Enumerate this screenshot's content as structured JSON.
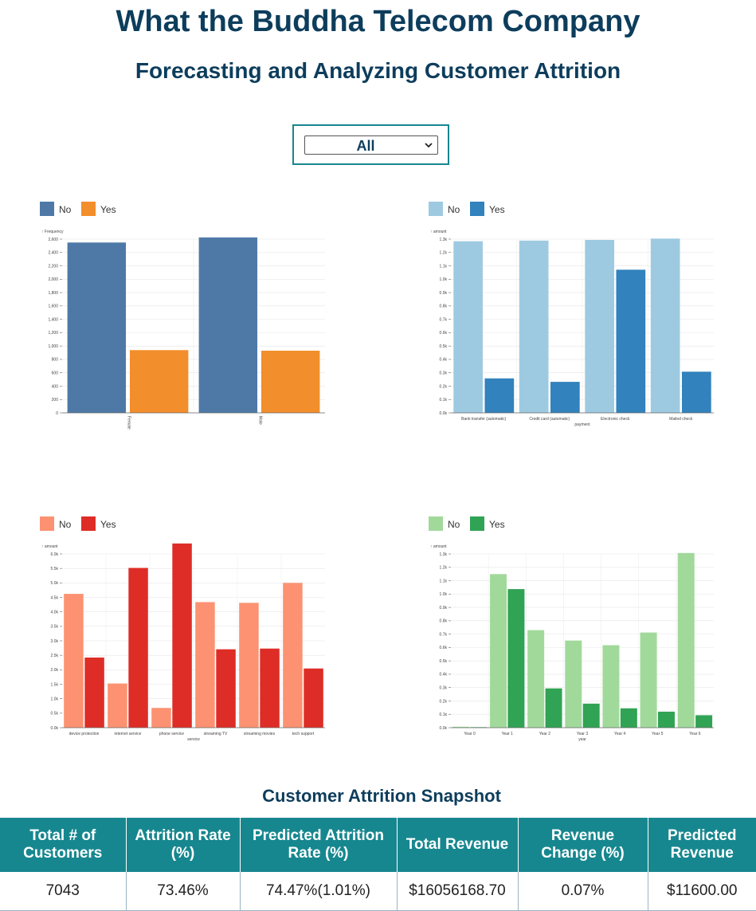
{
  "header": {
    "title": "What the Buddha Telecom Company",
    "subtitle": "Forecasting and Analyzing Customer Attrition"
  },
  "filter": {
    "selected": "All"
  },
  "chart_data": [
    {
      "id": "gender",
      "type": "bar",
      "categories": [
        "Female",
        "Male"
      ],
      "series": [
        {
          "name": "No",
          "values": [
            2549,
            2625
          ],
          "color": "#4e79a7"
        },
        {
          "name": "Yes",
          "values": [
            939,
            930
          ],
          "color": "#f28e2b"
        }
      ],
      "ylabel": "Frequency",
      "xlabel": "",
      "ylim": [
        0,
        2600
      ],
      "yticks": [
        0,
        200,
        400,
        600,
        800,
        1000,
        1200,
        1400,
        1600,
        1800,
        2000,
        2200,
        2400,
        2600
      ],
      "ytick_labels": [
        "0",
        "200",
        "400",
        "600",
        "800",
        "1,000",
        "1,200",
        "1,400",
        "1,600",
        "1,800",
        "2,000",
        "2,200",
        "2,400",
        "2,600"
      ],
      "xtick_rotated": true,
      "legend": "top-left"
    },
    {
      "id": "payment",
      "type": "bar",
      "categories": [
        "Bank transfer (automatic)",
        "Credit card (automatic)",
        "Electronic check",
        "Mailed check"
      ],
      "series": [
        {
          "name": "No",
          "values": [
            1284,
            1289,
            1294,
            1304
          ],
          "color": "#9ecae1"
        },
        {
          "name": "Yes",
          "values": [
            258,
            232,
            1071,
            308
          ],
          "color": "#3182bd"
        }
      ],
      "ylabel": "amount",
      "xlabel": "payment",
      "ylim": [
        0,
        1300
      ],
      "yticks": [
        0,
        100,
        200,
        300,
        400,
        500,
        600,
        700,
        800,
        900,
        1000,
        1100,
        1200,
        1300
      ],
      "ytick_labels": [
        "0.0k",
        "0.1k",
        "0.2k",
        "0.3k",
        "0.4k",
        "0.5k",
        "0.6k",
        "0.7k",
        "0.8k",
        "0.9k",
        "1.0k",
        "1.1k",
        "1.2k",
        "1.3k"
      ],
      "legend": "top-left"
    },
    {
      "id": "service",
      "type": "bar",
      "categories": [
        "device protection",
        "internet service",
        "phone service",
        "streaming TV",
        "streaming movies",
        "tech support"
      ],
      "series": [
        {
          "name": "No",
          "values": [
            4621,
            1526,
            682,
            4336,
            4311,
            4999
          ],
          "color": "#fc9272"
        },
        {
          "name": "Yes",
          "values": [
            2422,
            5517,
            6361,
            2707,
            2732,
            2044
          ],
          "color": "#de2d26"
        }
      ],
      "ylabel": "amount",
      "xlabel": "service",
      "ylim": [
        0,
        6000
      ],
      "yticks": [
        0,
        500,
        1000,
        1500,
        2000,
        2500,
        3000,
        3500,
        4000,
        4500,
        5000,
        5500,
        6000
      ],
      "ytick_labels": [
        "0.0k",
        "0.5k",
        "1.0k",
        "1.5k",
        "2.0k",
        "2.5k",
        "3.0k",
        "3.5k",
        "4.0k",
        "4.5k",
        "5.0k",
        "5.5k",
        "6.0k"
      ],
      "legend": "top-left"
    },
    {
      "id": "tenure",
      "type": "bar",
      "categories": [
        "Year 0",
        "Year 1",
        "Year 2",
        "Year 3",
        "Year 4",
        "Year 5",
        "Year 6"
      ],
      "series": [
        {
          "name": "No",
          "values": [
            7,
            1149,
            730,
            652,
            617,
            712,
            1307
          ],
          "color": "#a1d99b"
        },
        {
          "name": "Yes",
          "values": [
            4,
            1037,
            294,
            180,
            145,
            120,
            93
          ],
          "color": "#31a354"
        }
      ],
      "ylabel": "amount",
      "xlabel": "year",
      "ylim": [
        0,
        1300
      ],
      "yticks": [
        0,
        100,
        200,
        300,
        400,
        500,
        600,
        700,
        800,
        900,
        1000,
        1100,
        1200,
        1300
      ],
      "ytick_labels": [
        "0.0k",
        "0.1k",
        "0.2k",
        "0.3k",
        "0.4k",
        "0.5k",
        "0.6k",
        "0.7k",
        "0.8k",
        "0.9k",
        "1.0k",
        "1.1k",
        "1.2k",
        "1.3k"
      ],
      "legend": "top-left"
    }
  ],
  "snapshot": {
    "title": "Customer Attrition Snapshot",
    "headers": [
      "Total # of Customers",
      "Attrition Rate (%)",
      "Predicted Attrition Rate (%)",
      "Total Revenue",
      "Revenue Change (%)",
      "Predicted Revenue"
    ],
    "values": [
      "7043",
      "73.46%",
      "74.47%(1.01%)",
      "$16056168.70",
      "0.07%",
      "$11600.00"
    ]
  }
}
